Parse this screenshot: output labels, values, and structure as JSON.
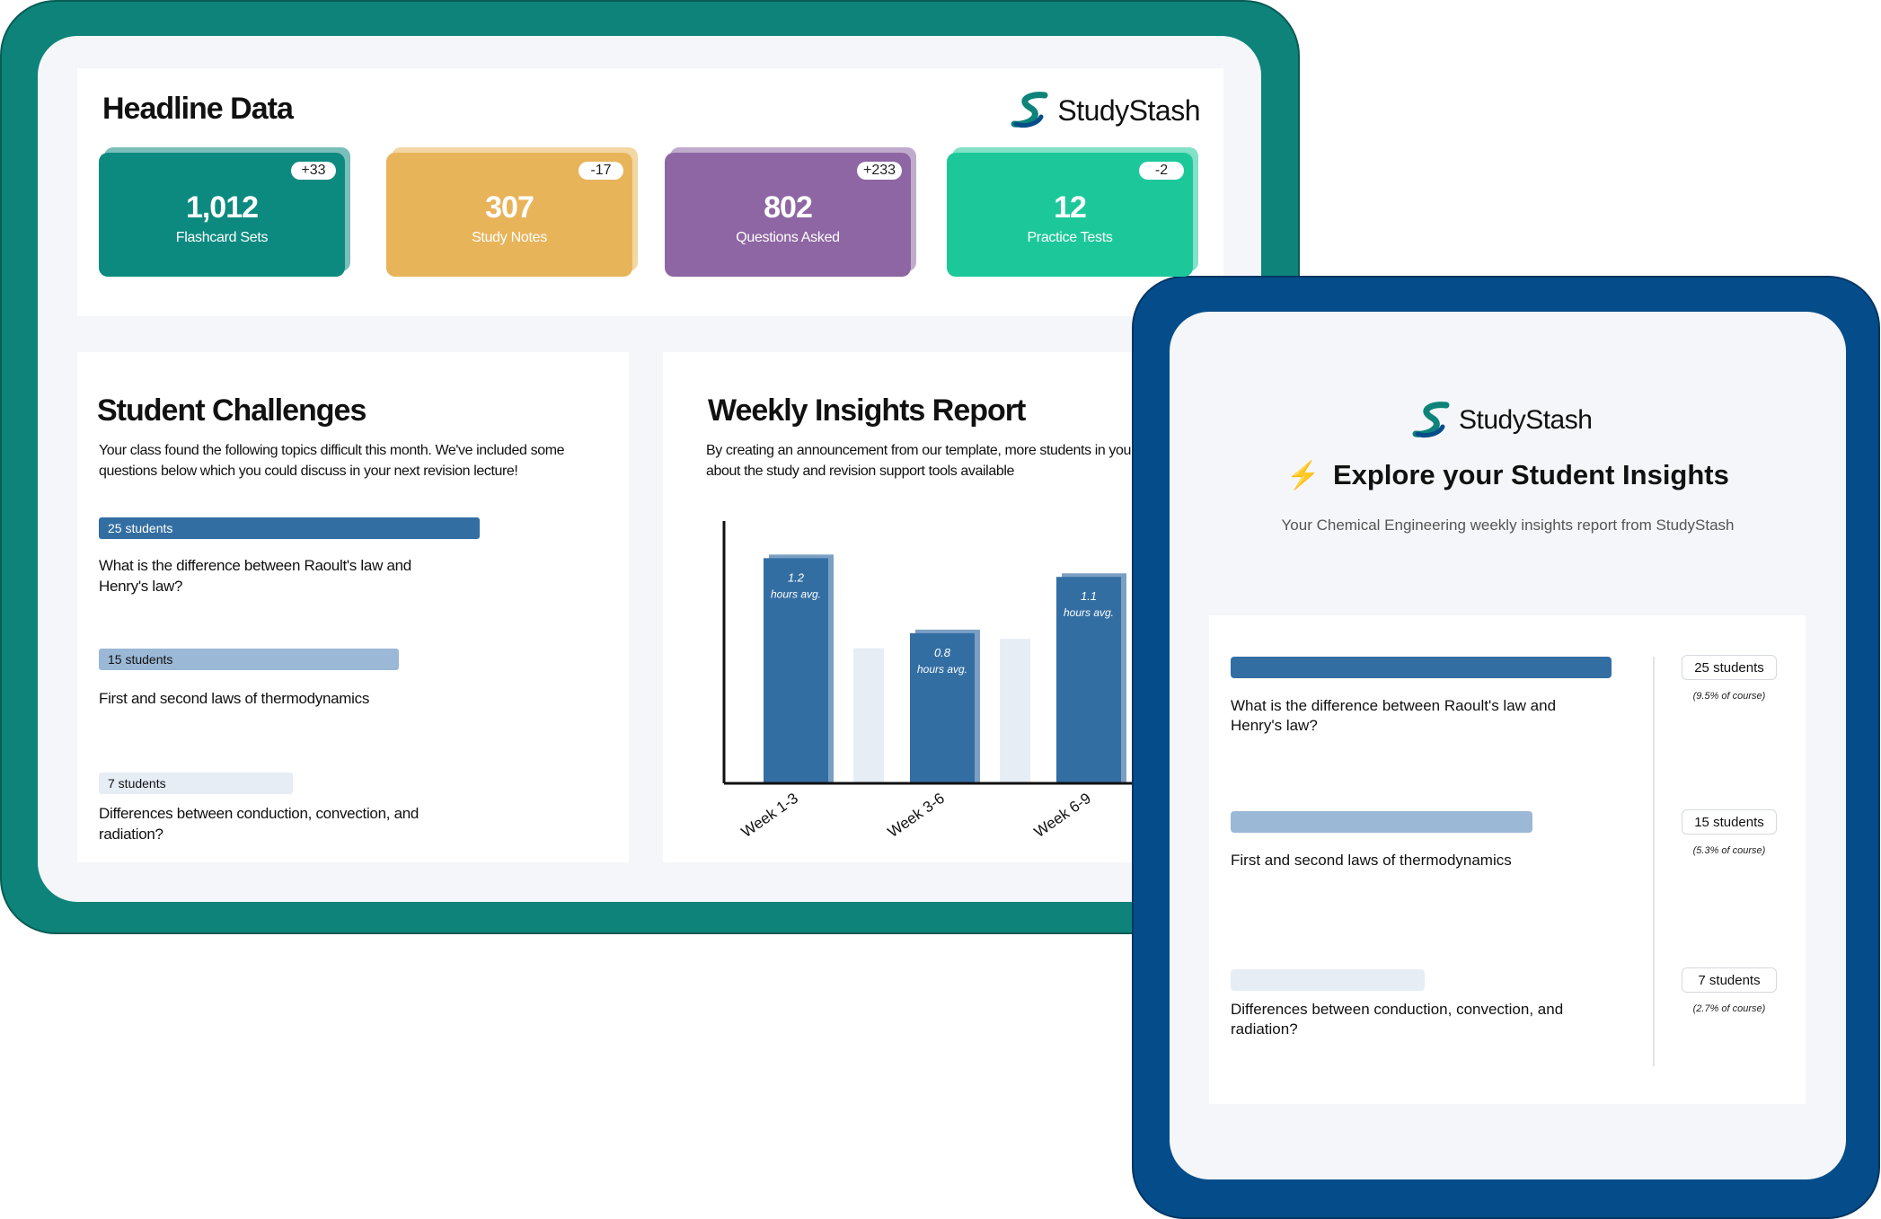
{
  "brand": {
    "name": "StudyStash",
    "colors": {
      "teal": "#0d8379",
      "navy": "#054d8a",
      "bar_blue": "#336ea3",
      "bar_light": "#9bb8d6",
      "bar_pale": "#e6edf5"
    }
  },
  "headline": {
    "title": "Headline Data",
    "stats": [
      {
        "value": "1,012",
        "label": "Flashcard Sets",
        "delta": "+33",
        "color": "#0d8a80"
      },
      {
        "value": "307",
        "label": "Study Notes",
        "delta": "-17",
        "color": "#e8b45a"
      },
      {
        "value": "802",
        "label": "Questions Asked",
        "delta": "+233",
        "color": "#8e66a3"
      },
      {
        "value": "12",
        "label": "Practice Tests",
        "delta": "-2",
        "color": "#1cc89a"
      }
    ]
  },
  "challenges": {
    "title": "Student Challenges",
    "intro": "Your class found the following topics difficult this month. We've included some questions below which you could discuss in your next revision lecture!",
    "items": [
      {
        "count_label": "25 students",
        "question": "What is the difference between Raoult's law and Henry's law?",
        "students": 25
      },
      {
        "count_label": "15 students",
        "question": "First and second laws of thermodynamics",
        "students": 15
      },
      {
        "count_label": "7 students",
        "question": "Differences between conduction, convection, and radiation?",
        "students": 7
      }
    ]
  },
  "weekly": {
    "title": "Weekly Insights Report",
    "intro": "By creating an announcement from our template, more students in your class will hear about the study and revision support tools available"
  },
  "chart_data": {
    "type": "bar",
    "categories": [
      "Week 1-3",
      "Week 3-6",
      "Week 6-9"
    ],
    "series": [
      {
        "values": [
          1.2,
          0.8,
          1.1
        ]
      },
      {
        "values": [
          0.72,
          0.77,
          null
        ]
      }
    ],
    "data_labels": [
      "1.2 hours avg.",
      "0.8 hours avg.",
      "1.1 hours avg."
    ],
    "ylim": [
      0,
      1.35
    ],
    "grid": false
  },
  "insights": {
    "icon": "lightning-icon",
    "title": "Explore your Student Insights",
    "subtitle": "Your Chemical Engineering weekly insights report from StudyStash",
    "items": [
      {
        "question": "What is the difference between Raoult's law and Henry's law?",
        "count_label": "25 students",
        "percent": "(9.5% of course)"
      },
      {
        "question": "First and second laws of thermodynamics",
        "count_label": "15 students",
        "percent": "(5.3% of course)"
      },
      {
        "question": "Differences between conduction, convection, and radiation?",
        "count_label": "7 students",
        "percent": "(2.7% of course)"
      }
    ]
  }
}
